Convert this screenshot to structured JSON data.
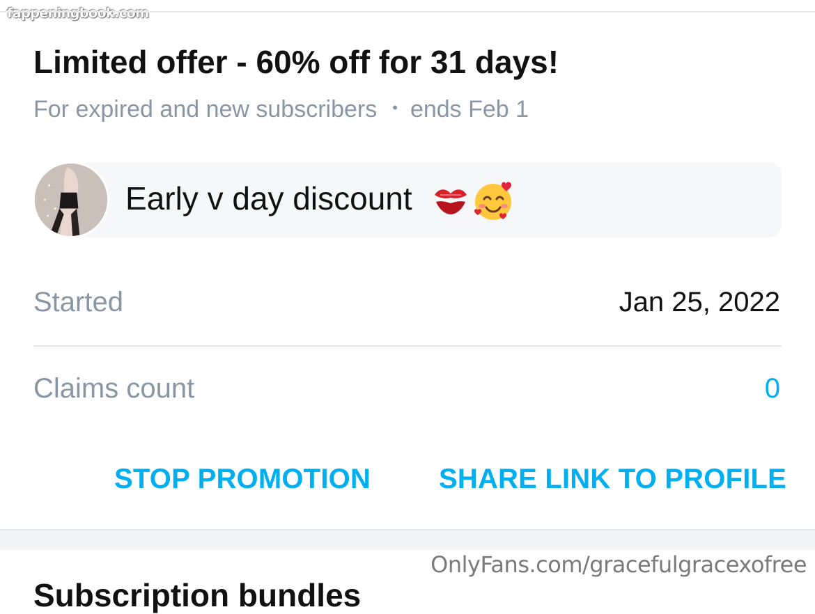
{
  "watermark_top": "fappeningbook.com",
  "offer": {
    "title": "Limited offer - 60% off for 31 days!",
    "audience": "For expired and new subscribers",
    "separator": "•",
    "ends": "ends Feb 1"
  },
  "message": {
    "text": "Early v day discount",
    "emojis": [
      "kiss-mark-icon",
      "smiling-face-with-hearts-icon"
    ]
  },
  "details": {
    "started_label": "Started",
    "started_value": "Jan 25, 2022",
    "claims_label": "Claims count",
    "claims_value": "0"
  },
  "actions": {
    "stop_label": "STOP PROMOTION",
    "share_label": "SHARE LINK TO PROFILE"
  },
  "watermark_bottom": "OnlyFans.com/gracefulgracexofree",
  "next_section": {
    "title": "Subscription bundles"
  },
  "colors": {
    "accent": "#00aff0",
    "muted_text": "#8a96a3",
    "primary_text": "#111111",
    "card_bg": "#f6f7f8"
  }
}
